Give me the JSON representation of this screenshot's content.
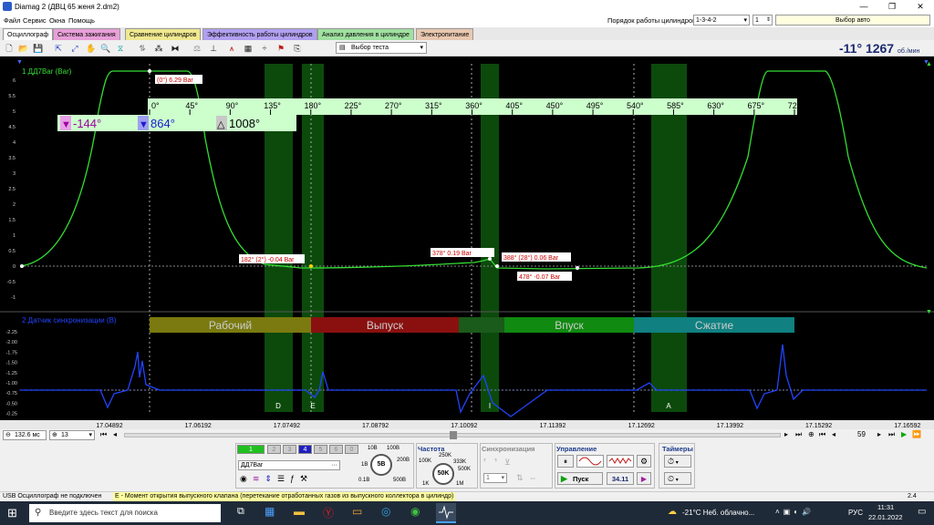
{
  "window": {
    "title": "Diamag 2 (ДВЦ 65 женя 2.dm2)",
    "minimize": "—",
    "maximize": "❐",
    "close": "✕"
  },
  "menu": {
    "items": [
      "Файл",
      "Сервис",
      "Окна",
      "Помощь"
    ],
    "firing_order_label": "Порядок работы цилиндров",
    "firing_order_value": "1-3-4-2",
    "cylinder_value": "1",
    "auto_select_value": "Выбор авто"
  },
  "tabs": [
    {
      "label": "Осциллограф",
      "color": "#ffffff"
    },
    {
      "label": "Система зажигания",
      "color": "#e8a0d8"
    },
    {
      "label": "Сравнение цилиндров",
      "color": "#f0e890"
    },
    {
      "label": "Эффективность работы цилиндров",
      "color": "#b0a0f0"
    },
    {
      "label": "Анализ давления в цилиндре",
      "color": "#a0e0a0"
    },
    {
      "label": "Электропитание",
      "color": "#e8c8b0"
    }
  ],
  "toolbar": {
    "test_select": "Выбор теста",
    "angle_readout": "-11°",
    "rpm_readout": "1267",
    "rpm_unit": "об./мин"
  },
  "colors": {
    "pressure_trace": "#33dd33",
    "sync_trace": "#2244ff",
    "phase_bar": "#0c4a0c",
    "marker_red": "#cc0000"
  },
  "channel1": {
    "label": "1 ДД7Bar (Bar)",
    "y_ticks": [
      "6",
      "5.5",
      "5",
      "4.5",
      "4",
      "3.5",
      "3",
      "2.5",
      "2",
      "1.5",
      "1",
      "0.5",
      "0",
      "-0.5",
      "-1"
    ]
  },
  "channel2": {
    "label": "2 Датчик синхронизации (В)",
    "y_ticks": [
      "-2.25",
      "-2.00",
      "-1.75",
      "-1.50",
      "-1.25",
      "-1.00",
      "-0.75",
      "-0.50",
      "-0.25",
      "0",
      "0.25",
      "0.50"
    ]
  },
  "angle_scale": [
    "0°",
    "45°",
    "90°",
    "135°",
    "180°",
    "225°",
    "270°",
    "315°",
    "360°",
    "405°",
    "450°",
    "495°",
    "540°",
    "585°",
    "630°",
    "675°",
    "720°"
  ],
  "cursors": {
    "left": "-144°",
    "right": "864°",
    "delta": "1008°"
  },
  "markers": [
    {
      "text": "(0°) 6.29 Bar"
    },
    {
      "text": "182° (2°) -0.04 Bar"
    },
    {
      "text": "378° 0.19 Bar"
    },
    {
      "text": "388° (28°) 0.06 Bar"
    },
    {
      "text": "478° -0.07 Bar"
    }
  ],
  "strokes": [
    {
      "label": "Рабочий",
      "color": "#7a7a10"
    },
    {
      "label": "Выпуск",
      "color": "#8a1010"
    },
    {
      "label": "Впуск",
      "color": "#108a10"
    },
    {
      "label": "Сжатие",
      "color": "#108080"
    }
  ],
  "valve_letters": [
    "D",
    "E",
    "I",
    "A"
  ],
  "time_axis": [
    "17.04892",
    "17.06192",
    "17.07492",
    "17.08792",
    "17.10092",
    "17.11392",
    "17.12692",
    "17.13992",
    "17.15292",
    "17.16592"
  ],
  "nav": {
    "timebase": "132.6 мс",
    "zoom": "13",
    "page": "59"
  },
  "controls": {
    "channel_buttons": [
      "1",
      "2",
      "3",
      "4",
      "5",
      "6",
      "0"
    ],
    "channel_name": "ДД7Bar",
    "volt_center": "5В",
    "volt_labels": [
      "10В",
      "100В",
      "200В",
      "1В",
      "0.1В",
      "500В"
    ],
    "freq_title": "Частота",
    "freq_center": "50K",
    "freq_labels": [
      "100K",
      "250K",
      "333K",
      "500K",
      "1K",
      "1M"
    ],
    "sync_title": "Синхронизация",
    "sync_value": "1",
    "control_title": "Управление",
    "start_label": "Пуск",
    "freq_readout": "34.11",
    "timers_title": "Таймеры"
  },
  "status": {
    "left": "USB Осциллограф не подключен",
    "message": "E - Момент открытия выпускного клапана (перетекание отработанных газов из выпускного коллектора в цилиндр)",
    "right": "2.4"
  },
  "taskbar": {
    "search_placeholder": "Введите здесь текст для поиска",
    "weather": "-21°C  Неб. облачно...",
    "lang": "РУС",
    "time": "11:31",
    "date": "22.01.2022"
  }
}
